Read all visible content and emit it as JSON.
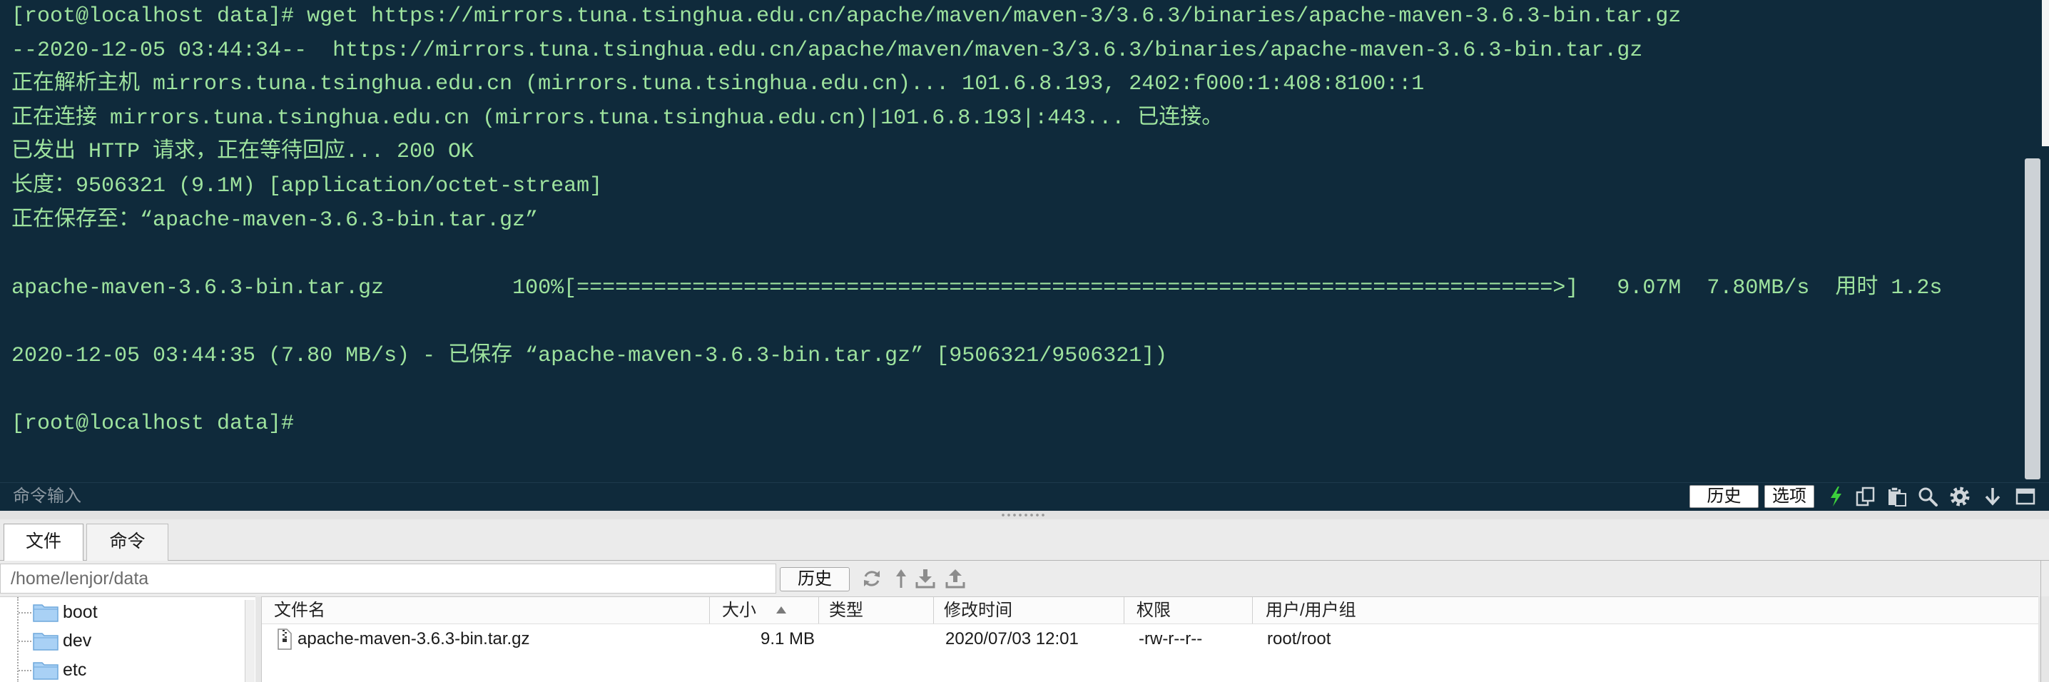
{
  "colors": {
    "terminal_bg": "#0f2a3b",
    "terminal_text": "#9ee39e",
    "accent_green": "#3ccf3c",
    "panel_bg": "#ebebeb"
  },
  "terminal": {
    "lines": [
      "[root@localhost data]# wget https://mirrors.tuna.tsinghua.edu.cn/apache/maven/maven-3/3.6.3/binaries/apache-maven-3.6.3-bin.tar.gz",
      "--2020-12-05 03:44:34--  https://mirrors.tuna.tsinghua.edu.cn/apache/maven/maven-3/3.6.3/binaries/apache-maven-3.6.3-bin.tar.gz",
      "正在解析主机 mirrors.tuna.tsinghua.edu.cn (mirrors.tuna.tsinghua.edu.cn)... 101.6.8.193, 2402:f000:1:408:8100::1",
      "正在连接 mirrors.tuna.tsinghua.edu.cn (mirrors.tuna.tsinghua.edu.cn)|101.6.8.193|:443... 已连接。",
      "已发出 HTTP 请求，正在等待回应... 200 OK",
      "长度：9506321 (9.1M) [application/octet-stream]",
      "正在保存至：“apache-maven-3.6.3-bin.tar.gz”",
      "",
      "apache-maven-3.6.3-bin.tar.gz          100%[============================================================================>]   9.07M  7.80MB/s  用时 1.2s",
      "",
      "2020-12-05 03:44:35 (7.80 MB/s) - 已保存 “apache-maven-3.6.3-bin.tar.gz” [9506321/9506321])",
      "",
      "[root@localhost data]#"
    ],
    "command_input": {
      "placeholder": "命令输入"
    },
    "history_button": "历史",
    "options_button": "选项",
    "toolbar_icons": [
      "lightning-icon",
      "copy-icon",
      "paste-icon",
      "search-icon",
      "gear-icon",
      "arrow-down-icon",
      "maximize-icon"
    ]
  },
  "tabs": [
    {
      "label": "文件",
      "active": true
    },
    {
      "label": "命令",
      "active": false
    }
  ],
  "path_bar": {
    "path": "/home/lenjor/data",
    "history_button": "历史",
    "icons": [
      "refresh-icon",
      "up-arrow-icon",
      "download-icon",
      "upload-icon"
    ]
  },
  "file_tree": {
    "items": [
      {
        "name": "boot",
        "icon": "folder-icon"
      },
      {
        "name": "dev",
        "icon": "folder-icon"
      },
      {
        "name": "etc",
        "icon": "folder-icon"
      }
    ]
  },
  "file_list": {
    "columns": [
      {
        "label": "文件名"
      },
      {
        "label": "大小",
        "sort_icon": "sort-ascending-icon"
      },
      {
        "label": "类型"
      },
      {
        "label": "修改时间"
      },
      {
        "label": "权限"
      },
      {
        "label": "用户/用户组"
      }
    ],
    "rows": [
      {
        "icon": "archive-file-icon",
        "name": "apache-maven-3.6.3-bin.tar.gz",
        "size": "9.1 MB",
        "type": "",
        "modified": "2020/07/03 12:01",
        "permissions": "-rw-r--r--",
        "owner": "root/root"
      }
    ]
  }
}
